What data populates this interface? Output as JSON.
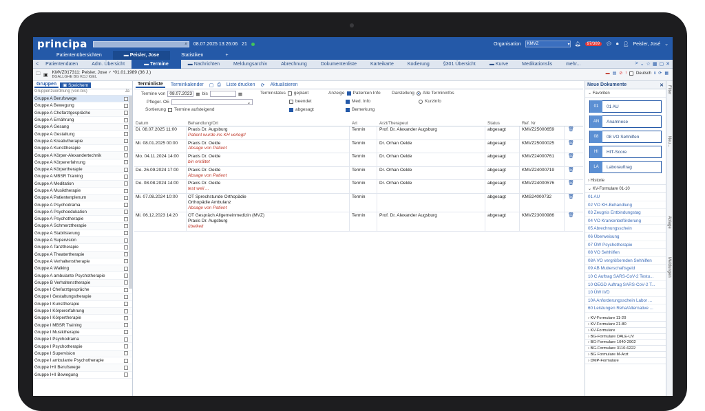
{
  "app": {
    "logo": "principa",
    "datetime": "08.07.2025 13:26:06",
    "counter": "21",
    "org_label": "Organisation",
    "org_value": "KMVZ",
    "notif_badge": "97/309",
    "user": "Peisler, José"
  },
  "nav": [
    {
      "label": "Patientenübersichten"
    },
    {
      "label": "Peisler, Jose"
    },
    {
      "label": "Statistiken"
    },
    {
      "label": "+"
    }
  ],
  "tabs": [
    "Patientendaten",
    "Adm. Übersicht",
    "Termine",
    "Nachrichten",
    "Meldungsarchiv",
    "Abrechnung",
    "Dokumentenliste",
    "Karteikarte",
    "Kodierung",
    "§301 Übersicht",
    "Kurve",
    "Medikationslis",
    "mehr..."
  ],
  "patient": {
    "line1": "KMVZ017311: Peisler, Jose ♂ *01.01.1989 (36 J.)",
    "line2": "BGALLGHE BG KOJ IGEL",
    "deutsch": "Deutsch"
  },
  "left": {
    "tab_groups": "Gruppen",
    "tab_save": "Speichern",
    "head_name": "Gruppenzuordnung (von-bis)",
    "head_ja": "Ja",
    "items": [
      "Gruppe A Berufswege",
      "Gruppe A Bewegung",
      "Gruppe A Chefarztgespräche",
      "Gruppe A Ernährung",
      "Gruppe A Gesang",
      "Gruppe A Gestaltung",
      "Gruppe A Kreativtherapie",
      "Gruppe A Kunsttherapie",
      "Gruppe A Körper-Alexandertechnik",
      "Gruppe A Körpererfahrung",
      "Gruppe A Körpertherapie",
      "Gruppe A MBSR Training",
      "Gruppe A Meditation",
      "Gruppe A Musiktherapie",
      "Gruppe A Patientenplenum",
      "Gruppe A Psychodrama",
      "Gruppe A Psychoedukation",
      "Gruppe A Psychotherapie",
      "Gruppe A Schmerztherapie",
      "Gruppe A Stabilisierung",
      "Gruppe A Supervision",
      "Gruppe A Tanztherapie",
      "Gruppe A Theatertherapie",
      "Gruppe A Verhaltenstherapie",
      "Gruppe A Walking",
      "Gruppe A ambulante Psychotherapie",
      "Gruppe B Verhaltenstherapie",
      "Gruppe I Chefarztgespräche",
      "Gruppe I Gestaltungstherapie",
      "Gruppe I Kunsttherapie",
      "Gruppe I Körpererfahrung",
      "Gruppe I Körpertherapie",
      "Gruppe I MBSR Training",
      "Gruppe I Musiktherapie",
      "Gruppe I Psychodrama",
      "Gruppe I Psychotherapie",
      "Gruppe I Supervision",
      "Gruppe I ambulante Psychotherapie",
      "Gruppe I+II Berufswege",
      "Gruppe I+II Bewegung"
    ]
  },
  "center": {
    "tab_list": "Terminliste",
    "tab_cal": "Terminkalender",
    "print": "Liste drucken",
    "refresh": "Aktualisieren",
    "termine_von": "Termine von",
    "date_from": "08.07.2023",
    "bis": "bis",
    "pfleger": "Pfleger. OE",
    "sortierung": "Sortierung",
    "aufsteigend": "Termine aufsteigend",
    "terminstatus": "Terminstatus",
    "st_geplant": "geplant",
    "st_beendet": "beendet",
    "st_abgesagt": "abgesagt",
    "anzeige": "Anzeige",
    "an_patient": "Patienten Info",
    "an_med": "Med. Info",
    "an_bem": "Bemerkung",
    "darstellung": "Darstellung",
    "d_alle": "Alle Termininfos",
    "d_kurz": "Kurzinfo",
    "cols": {
      "datum": "Datum",
      "behandlung": "Behandlung/Ort",
      "art": "Art",
      "arzt": "Arzt/Therapeut",
      "status": "Status",
      "ref": "Ref. Nr"
    },
    "rows": [
      {
        "datum": "Di. 08.07.2025 11:00",
        "lines": [
          "Praxis Dr. Augsburg"
        ],
        "note": "Patient wurde ins KH verlegt!",
        "art": "Termin",
        "arzt": "Prof. Dr. Alexander Augsburg",
        "status": "abgesagt",
        "ref": "KMVZ25000659"
      },
      {
        "datum": "Mi. 08.01.2025 00:00",
        "lines": [
          "Praxis Dr. Oelde"
        ],
        "note": "Absage von Patient",
        "art": "Termin",
        "arzt": "Dr. Orhan Oelde",
        "status": "abgesagt",
        "ref": "KMVZ25000025"
      },
      {
        "datum": "Mo. 04.11.2024 14:00",
        "lines": [
          "Praxis Dr. Oelde"
        ],
        "note": "bin erkältet",
        "art": "Termin",
        "arzt": "Dr. Orhan Oelde",
        "status": "abgesagt",
        "ref": "KMVZ24000761"
      },
      {
        "datum": "Do. 26.09.2024 17:00",
        "lines": [
          "Praxis Dr. Oelde"
        ],
        "note": "Absage von Patient",
        "art": "Termin",
        "arzt": "Dr. Orhan Oelde",
        "status": "abgesagt",
        "ref": "KMVZ24000719"
      },
      {
        "datum": "Do. 08.08.2024 14:00",
        "lines": [
          "Praxis Dr. Oelde"
        ],
        "note": "test weil ...",
        "art": "Termin",
        "arzt": "Dr. Orhan Oelde",
        "status": "abgesagt",
        "ref": "KMVZ24000576"
      },
      {
        "datum": "Mi. 07.08.2024 10:00",
        "lines": [
          "OT Sprechstunde Orthopädie",
          "Orthopädie Ambulanz"
        ],
        "note": "Absage von Patient",
        "art": "Termin",
        "arzt": "",
        "status": "abgesagt",
        "ref": "KMS24000732"
      },
      {
        "datum": "Mi. 06.12.2023 14:20",
        "lines": [
          "OT Gespräch Allgemeinmedizin (MVZ)",
          "Praxis Dr. Augsburg"
        ],
        "note": "übelkeit",
        "art": "Termin",
        "arzt": "Prof. Dr. Alexander Augsburg",
        "status": "abgesagt",
        "ref": "KMVZ23000986"
      }
    ]
  },
  "right": {
    "title": "Neue Dokumente",
    "favoriten": "Favoriten",
    "favs": [
      {
        "abbr": "01",
        "label": "01 AU"
      },
      {
        "abbr": "AN",
        "label": "Anamnese"
      },
      {
        "abbr": "08",
        "label": "08 VO Sehhilfen"
      },
      {
        "abbr": "HI",
        "label": "HIT-Score"
      },
      {
        "abbr": "LA",
        "label": "Laborauftrag"
      }
    ],
    "historie": "Historie",
    "kv": "KV-Formulare 01-10",
    "kv_items": [
      "01 AU",
      "02 VO KH-Behandlung",
      "03 Zeugnis Entbindungstag",
      "04 VO Krankenbeförderung",
      "05 Abrechnungsschein",
      "06 Überweisung",
      "07 ÜW Psychotherapie",
      "08 VO Sehhilfen",
      "08A VO vergrößernden Sehhilfen",
      "09 AB Mutterschaftsgeld",
      "10 C Auftrag SARS-CoV-2 Testu...",
      "10 OEGD Auftrag SARS-CoV-2 T...",
      "10 ÜW IVD",
      "10A Anforderungsschein Labor ...",
      "60 Leistungen Reha/Alternative ..."
    ],
    "groups": [
      "KV-Formulare 11-20",
      "KV-Formulare 21-80",
      "KV-Formulare",
      "BG-Formulare DALE-UV",
      "BG-Formulare 1040-2902",
      "BG-Formulare 3110-6222",
      "BG Formulare M-Arzt",
      "DMP-Formulare"
    ]
  },
  "vtabs": [
    "Filter",
    "Neu...",
    "Ablage",
    "Meldungen"
  ]
}
